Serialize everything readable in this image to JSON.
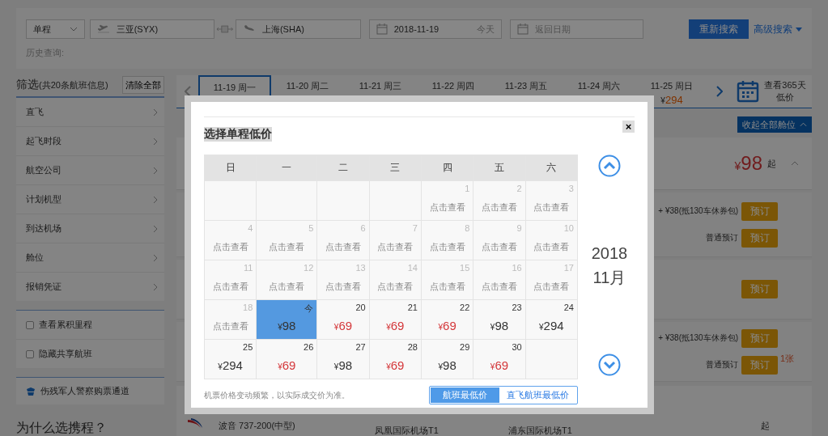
{
  "search": {
    "trip_type": "单程",
    "from": "三亚(SYX)",
    "to": "上海(SHA)",
    "depart_date": "2018-11-19",
    "depart_note": "今天",
    "return_placeholder": "返回日期",
    "search_button": "重新搜索",
    "advanced_link": "高级搜索",
    "history_label": "历史查询:"
  },
  "filter": {
    "title": "筛选",
    "count": "(共20条航班信息)",
    "clear_button": "清除全部",
    "items": [
      "直飞",
      "起飞时段",
      "航空公司",
      "计划机型",
      "到达机场",
      "舱位",
      "报销凭证"
    ],
    "options": [
      {
        "label": "查看累积里程",
        "checked": false
      },
      {
        "label": "隐藏共享航班",
        "checked": false
      }
    ],
    "channel": "伤残军人警察购票通道",
    "why_title": "为什么选携程？"
  },
  "date_tabs": [
    {
      "label": "11-19 周一",
      "selected": true
    },
    {
      "label": "11-20 周二",
      "selected": false
    },
    {
      "label": "11-21 周三",
      "selected": false
    },
    {
      "label": "11-22 周四",
      "selected": false
    },
    {
      "label": "11-23 周五",
      "selected": false
    },
    {
      "label": "11-24 周六",
      "selected": false
    },
    {
      "label": "11-25 周日",
      "selected": false,
      "currency": "¥",
      "price": "294"
    }
  ],
  "calendar_link": "查看365天低价",
  "collapse_button": "收起全部舱位",
  "result": {
    "currency": "¥",
    "price": "98",
    "suffix": "起",
    "groups": [
      {
        "rows": [
          {
            "note": "+ ¥38(抵130车休券包)",
            "button": "预订"
          },
          {
            "note": "普通预订",
            "button": "预订"
          }
        ]
      },
      {
        "rows": [
          {
            "button": "预订"
          }
        ]
      },
      {
        "rows": [
          {
            "note": "+ ¥38(抵130车休券包)",
            "button": "预订"
          },
          {
            "note": "普通预订",
            "button": "预订"
          }
        ],
        "badge": "1张"
      }
    ]
  },
  "next_flight": {
    "aircraft": "波音 737-200(中型)",
    "depart_airport": "凤凰国际机场T1",
    "arrive_airport": "浦东国际机场T1",
    "suffix": "起"
  },
  "modal": {
    "title": "选择单程低价",
    "close": "×",
    "weekdays": [
      "日",
      "一",
      "二",
      "三",
      "四",
      "五",
      "六"
    ],
    "weeks": [
      [
        {
          "kind": "blank"
        },
        {
          "kind": "blank"
        },
        {
          "kind": "blank"
        },
        {
          "kind": "blank"
        },
        {
          "kind": "past",
          "day": "1",
          "text": "点击查看"
        },
        {
          "kind": "past",
          "day": "2",
          "text": "点击查看"
        },
        {
          "kind": "past",
          "day": "3",
          "text": "点击查看"
        }
      ],
      [
        {
          "kind": "past",
          "day": "4",
          "text": "点击查看"
        },
        {
          "kind": "past",
          "day": "5",
          "text": "点击查看"
        },
        {
          "kind": "past",
          "day": "6",
          "text": "点击查看"
        },
        {
          "kind": "past",
          "day": "7",
          "text": "点击查看"
        },
        {
          "kind": "past",
          "day": "8",
          "text": "点击查看"
        },
        {
          "kind": "past",
          "day": "9",
          "text": "点击查看"
        },
        {
          "kind": "past",
          "day": "10",
          "text": "点击查看"
        }
      ],
      [
        {
          "kind": "past",
          "day": "11",
          "text": "点击查看"
        },
        {
          "kind": "past",
          "day": "12",
          "text": "点击查看"
        },
        {
          "kind": "past",
          "day": "13",
          "text": "点击查看"
        },
        {
          "kind": "past",
          "day": "14",
          "text": "点击查看"
        },
        {
          "kind": "past",
          "day": "15",
          "text": "点击查看"
        },
        {
          "kind": "past",
          "day": "16",
          "text": "点击查看"
        },
        {
          "kind": "past",
          "day": "17",
          "text": "点击查看"
        }
      ],
      [
        {
          "kind": "past",
          "day": "18",
          "text": "点击查看"
        },
        {
          "kind": "price",
          "day": "今",
          "currency": "¥",
          "price": "98",
          "low": false,
          "selected": true
        },
        {
          "kind": "price",
          "day": "20",
          "currency": "¥",
          "price": "69",
          "low": true,
          "selected": false
        },
        {
          "kind": "price",
          "day": "21",
          "currency": "¥",
          "price": "69",
          "low": true,
          "selected": false
        },
        {
          "kind": "price",
          "day": "22",
          "currency": "¥",
          "price": "69",
          "low": true,
          "selected": false
        },
        {
          "kind": "price",
          "day": "23",
          "currency": "¥",
          "price": "98",
          "low": false,
          "selected": false
        },
        {
          "kind": "price",
          "day": "24",
          "currency": "¥",
          "price": "294",
          "low": false,
          "selected": false
        }
      ],
      [
        {
          "kind": "price",
          "day": "25",
          "currency": "¥",
          "price": "294",
          "low": false,
          "selected": false
        },
        {
          "kind": "price",
          "day": "26",
          "currency": "¥",
          "price": "69",
          "low": true,
          "selected": false
        },
        {
          "kind": "price",
          "day": "27",
          "currency": "¥",
          "price": "98",
          "low": false,
          "selected": false
        },
        {
          "kind": "price",
          "day": "28",
          "currency": "¥",
          "price": "69",
          "low": true,
          "selected": false
        },
        {
          "kind": "price",
          "day": "29",
          "currency": "¥",
          "price": "98",
          "low": false,
          "selected": false
        },
        {
          "kind": "price",
          "day": "30",
          "currency": "¥",
          "price": "69",
          "low": true,
          "selected": false
        },
        {
          "kind": "blank"
        }
      ]
    ],
    "year": "2018",
    "month": "11月",
    "note": "机票价格变动频繁，以实际成交价为准。",
    "modes": [
      {
        "label": "航班最低价",
        "selected": true
      },
      {
        "label": "直飞航班最低价",
        "selected": false
      }
    ]
  }
}
